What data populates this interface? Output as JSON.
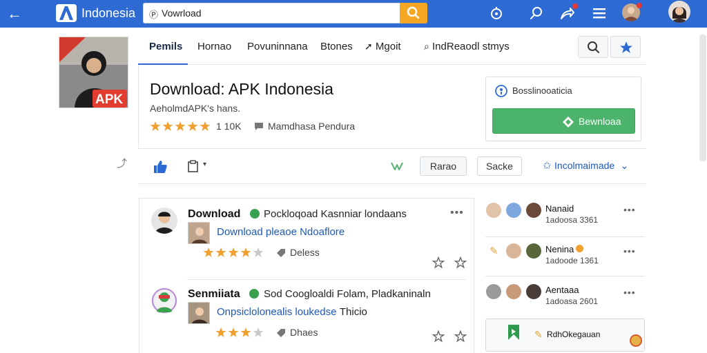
{
  "topbar": {
    "brand": "Indonesia",
    "search": {
      "lead_glyph": "Ⓟ",
      "value": "Vowrload"
    },
    "colors": {
      "bar": "#2e6ad3",
      "search_button": "#f5a623"
    }
  },
  "tabs": [
    {
      "label": "Pemils"
    },
    {
      "label": "Hornao"
    },
    {
      "label": "Povuninnana"
    },
    {
      "label": "Btones"
    },
    {
      "label": "Mgoit"
    },
    {
      "label": "IndReaodl stmys"
    }
  ],
  "app": {
    "title": "Download: APK Indonesia",
    "subtitle": "AeholmdAPK's hans.",
    "rating_stars": 5,
    "rating_count": "1 10K",
    "category": "Mamdhasa Pendura",
    "thumbnail_label": "APK"
  },
  "download_card": {
    "label": "Bosslinooaticia",
    "button_label": "Bewnloaa",
    "button_color": "#4cb36a"
  },
  "action_bar": {
    "rename_label": "Rarao",
    "save_label": "Sacke",
    "dropdown_label": "Incolmaimade"
  },
  "reviews": [
    {
      "name": "Download",
      "headline": "Pockloqoad Kasnniar londaans",
      "link": "Download pleaoe Ndoaflore",
      "stars": 4,
      "tag": "Deless"
    },
    {
      "name": "Senmiiata",
      "headline": "Sod Coogloaldi Folam, Pladkaninaln",
      "link": "Onpsiclolonealis loukedse",
      "link_suffix": "Thicio",
      "stars": 3,
      "tag": "Dhaes"
    }
  ],
  "sidebar": {
    "people": [
      {
        "name": "Nanaid",
        "sub": "1adoosa 3361"
      },
      {
        "name": "Nenina",
        "sub": "1adoode 1361"
      },
      {
        "name": "Aentaaa",
        "sub": "1adoasa 2601"
      }
    ],
    "card_label": "RdhOkegauan"
  }
}
